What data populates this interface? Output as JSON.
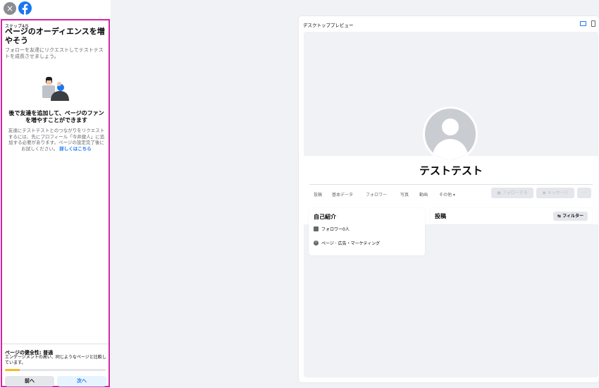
{
  "sidebar": {
    "close_label": "×",
    "step": "ステップ4/5",
    "title": "ページのオーディエンスを増やそう",
    "subtitle": "フォローを友達にリクエストしてテストテストを成長させましょう。",
    "promo_title": "後で友達を追加して、ページのファンを増やすことができます",
    "promo_body": "友達にテストテストとのつながりをリクエストするには、先にプロフィール「今井健人」に追加する必要があります。ページの設定完了後にお試しください。",
    "promo_link": "詳しくはこちら",
    "health_title": "ページの健全性: 普通",
    "health_desc": "エンゲージメントの高い、同じようなページと比較しています。",
    "health_level": 0.15,
    "back_label": "前へ",
    "next_label": "次へ"
  },
  "preview": {
    "label": "デスクトッププレビュー",
    "page_name": "テストテスト",
    "tabs": [
      "投稿",
      "基本データ",
      "フォロワー",
      "写真",
      "動画",
      "その他 ▾"
    ],
    "follow_label": "フォローする",
    "message_label": "メッセージ",
    "more_label": "···",
    "intro_title": "自己紹介",
    "followers": "フォロワー0人",
    "category": "ページ · 広告・マーケティング",
    "posts_title": "投稿",
    "filter_label": "フィルター"
  },
  "colors": {
    "accent": "#1877f2",
    "panel_border": "#d6249f",
    "health": "#f7b928"
  }
}
